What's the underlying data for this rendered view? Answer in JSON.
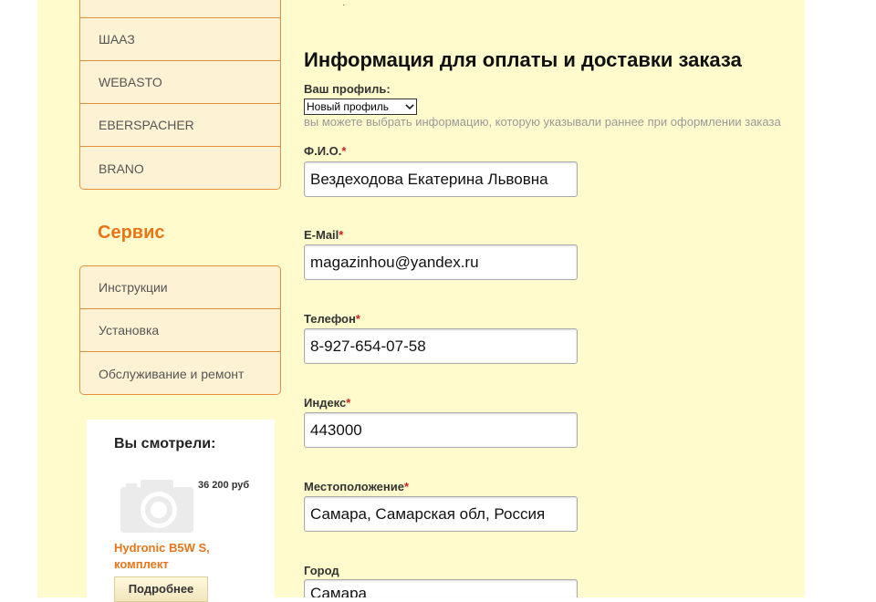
{
  "sidebar": {
    "brands": [
      "ШААЗ",
      "WEBASTO",
      "EBERSPACHER",
      "BRANO"
    ],
    "service_title": "Сервис",
    "service_items": [
      "Инструкции",
      "Установка",
      "Обслуживание и ремонт"
    ]
  },
  "viewed": {
    "title": "Вы смотрели:",
    "price": "36 200 руб",
    "product_name": "Hydronic B5W S, комплект",
    "more_label": "Подробнее",
    "image_icon": "camera-icon"
  },
  "form": {
    "heading": "Информация для оплаты и доставки заказа",
    "profile_label": "Ваш профиль:",
    "profile_selected": "Новый профиль",
    "profile_hint": "вы можете выбрать информацию, которую указывали раннее при оформлении заказа",
    "fields": [
      {
        "label": "Ф.И.О.",
        "required": "*",
        "value": "Вездеходова Екатерина Львовна"
      },
      {
        "label": "E-Mail",
        "required": "*",
        "value": "magazinhou@yandex.ru"
      },
      {
        "label": "Телефон",
        "required": "*",
        "value": "8-927-654-07-58"
      },
      {
        "label": "Индекс",
        "required": "*",
        "value": "443000"
      },
      {
        "label": "Местоположение",
        "required": "*",
        "value": "Самара, Самарская обл, Россия"
      },
      {
        "label": "Город",
        "required": "",
        "value": "Самара"
      }
    ]
  },
  "colors": {
    "page_bg": "#fffbcc",
    "accent": "#e8751a",
    "menu_border": "#e2923f",
    "required": "#cc2222"
  }
}
